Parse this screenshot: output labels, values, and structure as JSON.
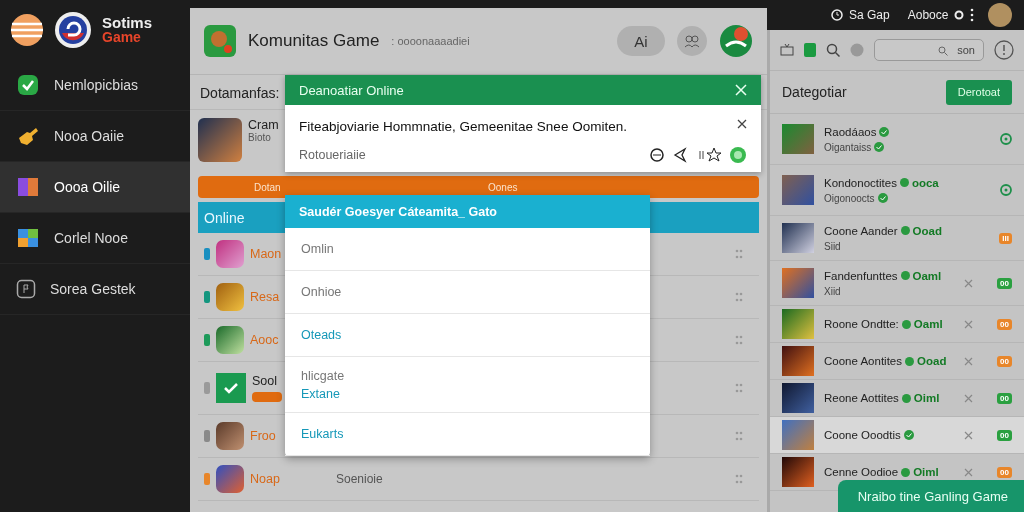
{
  "sidebar": {
    "logo": {
      "line1": "Sotims",
      "line2": "Game"
    },
    "items": [
      {
        "label": "Nemlopicbias",
        "selected": false
      },
      {
        "label": "Nooa Oaiie",
        "selected": false
      },
      {
        "label": "Oooa Oilie",
        "selected": true
      },
      {
        "label": "Corlel Nooe",
        "selected": false
      },
      {
        "label": "Sorea Gestek",
        "selected": false
      }
    ]
  },
  "top_bar": {
    "status": "Sa Gap",
    "user": "Aoboce"
  },
  "main": {
    "title": "Komunitas Game",
    "subtitle": ": oooonaaaadiei",
    "pill_button": "Ai",
    "section_label": "Dotamanfas:",
    "featured": {
      "name": "Cram",
      "sub": "Bioto"
    },
    "orange_bar": "Dotan",
    "online_bar": "Online",
    "rows": [
      {
        "name": "Maon",
        "color": "#1a8fc0",
        "kind": "plain"
      },
      {
        "name": "Resa",
        "color": "#14967f",
        "kind": "plain"
      },
      {
        "name": "Aooc",
        "color": "#1d9a5a",
        "kind": "plain"
      },
      {
        "name": "Sool",
        "color": "#9a9a9a",
        "kind": "badge"
      },
      {
        "name": "Froo",
        "color": "#8a8a8a",
        "kind": "plain"
      },
      {
        "name": "Noap",
        "color": "#e8862a",
        "kind": "plain",
        "detail": "Soenioie"
      }
    ]
  },
  "dialog": {
    "title": "Deanoatiar Online",
    "message": "Fiteabjoviarie Hommnatie, Gemeenitae Snee Oomiten.",
    "caption": "Rotoueriaiie",
    "action_bar": "Oones"
  },
  "dropdown": {
    "title": "Saudér Goesyer Cáteamita_ Gato",
    "items": [
      {
        "label": "Omlin",
        "highlighted": false
      },
      {
        "label": "Onhioe",
        "highlighted": false
      },
      {
        "label": "Oteads",
        "highlighted": true
      },
      {
        "label": "hlicgate",
        "sub": "Extane",
        "highlighted": false
      },
      {
        "label": "Eukarts",
        "highlighted": true
      }
    ]
  },
  "right_panel": {
    "search": {
      "placeholder": "son"
    },
    "heading": "Dategotiar",
    "button": "Derotoat",
    "items": [
      {
        "name": "Raodáaos",
        "sub": "Oigantaiss",
        "kind": "circle",
        "color": "#1d8f4a",
        "selected": false
      },
      {
        "name": "Kondonoctites",
        "tag": "ooca",
        "sub": "Oigonoocts",
        "kind": "circle",
        "color": "#1d8f4a",
        "selected": false
      },
      {
        "name": "Coone Aander",
        "tag": "Ooad",
        "sub": "Siid",
        "kind": "badge",
        "badge": "III",
        "color": "#e8862a",
        "selected": false
      },
      {
        "name": "Fandenfunttes",
        "tag": "Oaml",
        "sub": "Xiid",
        "kind": "badge",
        "badge": "00",
        "color": "#2aa040",
        "selected": false
      },
      {
        "name": "Roone Ondtte:",
        "tag": "Oaml",
        "kind": "badge",
        "badge": "00",
        "color": "#e8862a",
        "selected": false
      },
      {
        "name": "Coone Aontites",
        "tag": "Ooad",
        "kind": "badge",
        "badge": "00",
        "color": "#e8862a",
        "selected": false
      },
      {
        "name": "Reone Aottites",
        "tag": "Oiml",
        "kind": "badge",
        "badge": "00",
        "color": "#2aa040",
        "selected": false
      },
      {
        "name": "Coone Ooodtis",
        "kind": "badge",
        "badge": "00",
        "color": "#2aa040",
        "selected": true
      },
      {
        "name": "Cenne Oodioe",
        "tag": "Oiml",
        "kind": "badge",
        "badge": "00",
        "color": "#e8862a",
        "selected": false
      }
    ]
  },
  "toast": "Nraibo tine Ganling Game"
}
